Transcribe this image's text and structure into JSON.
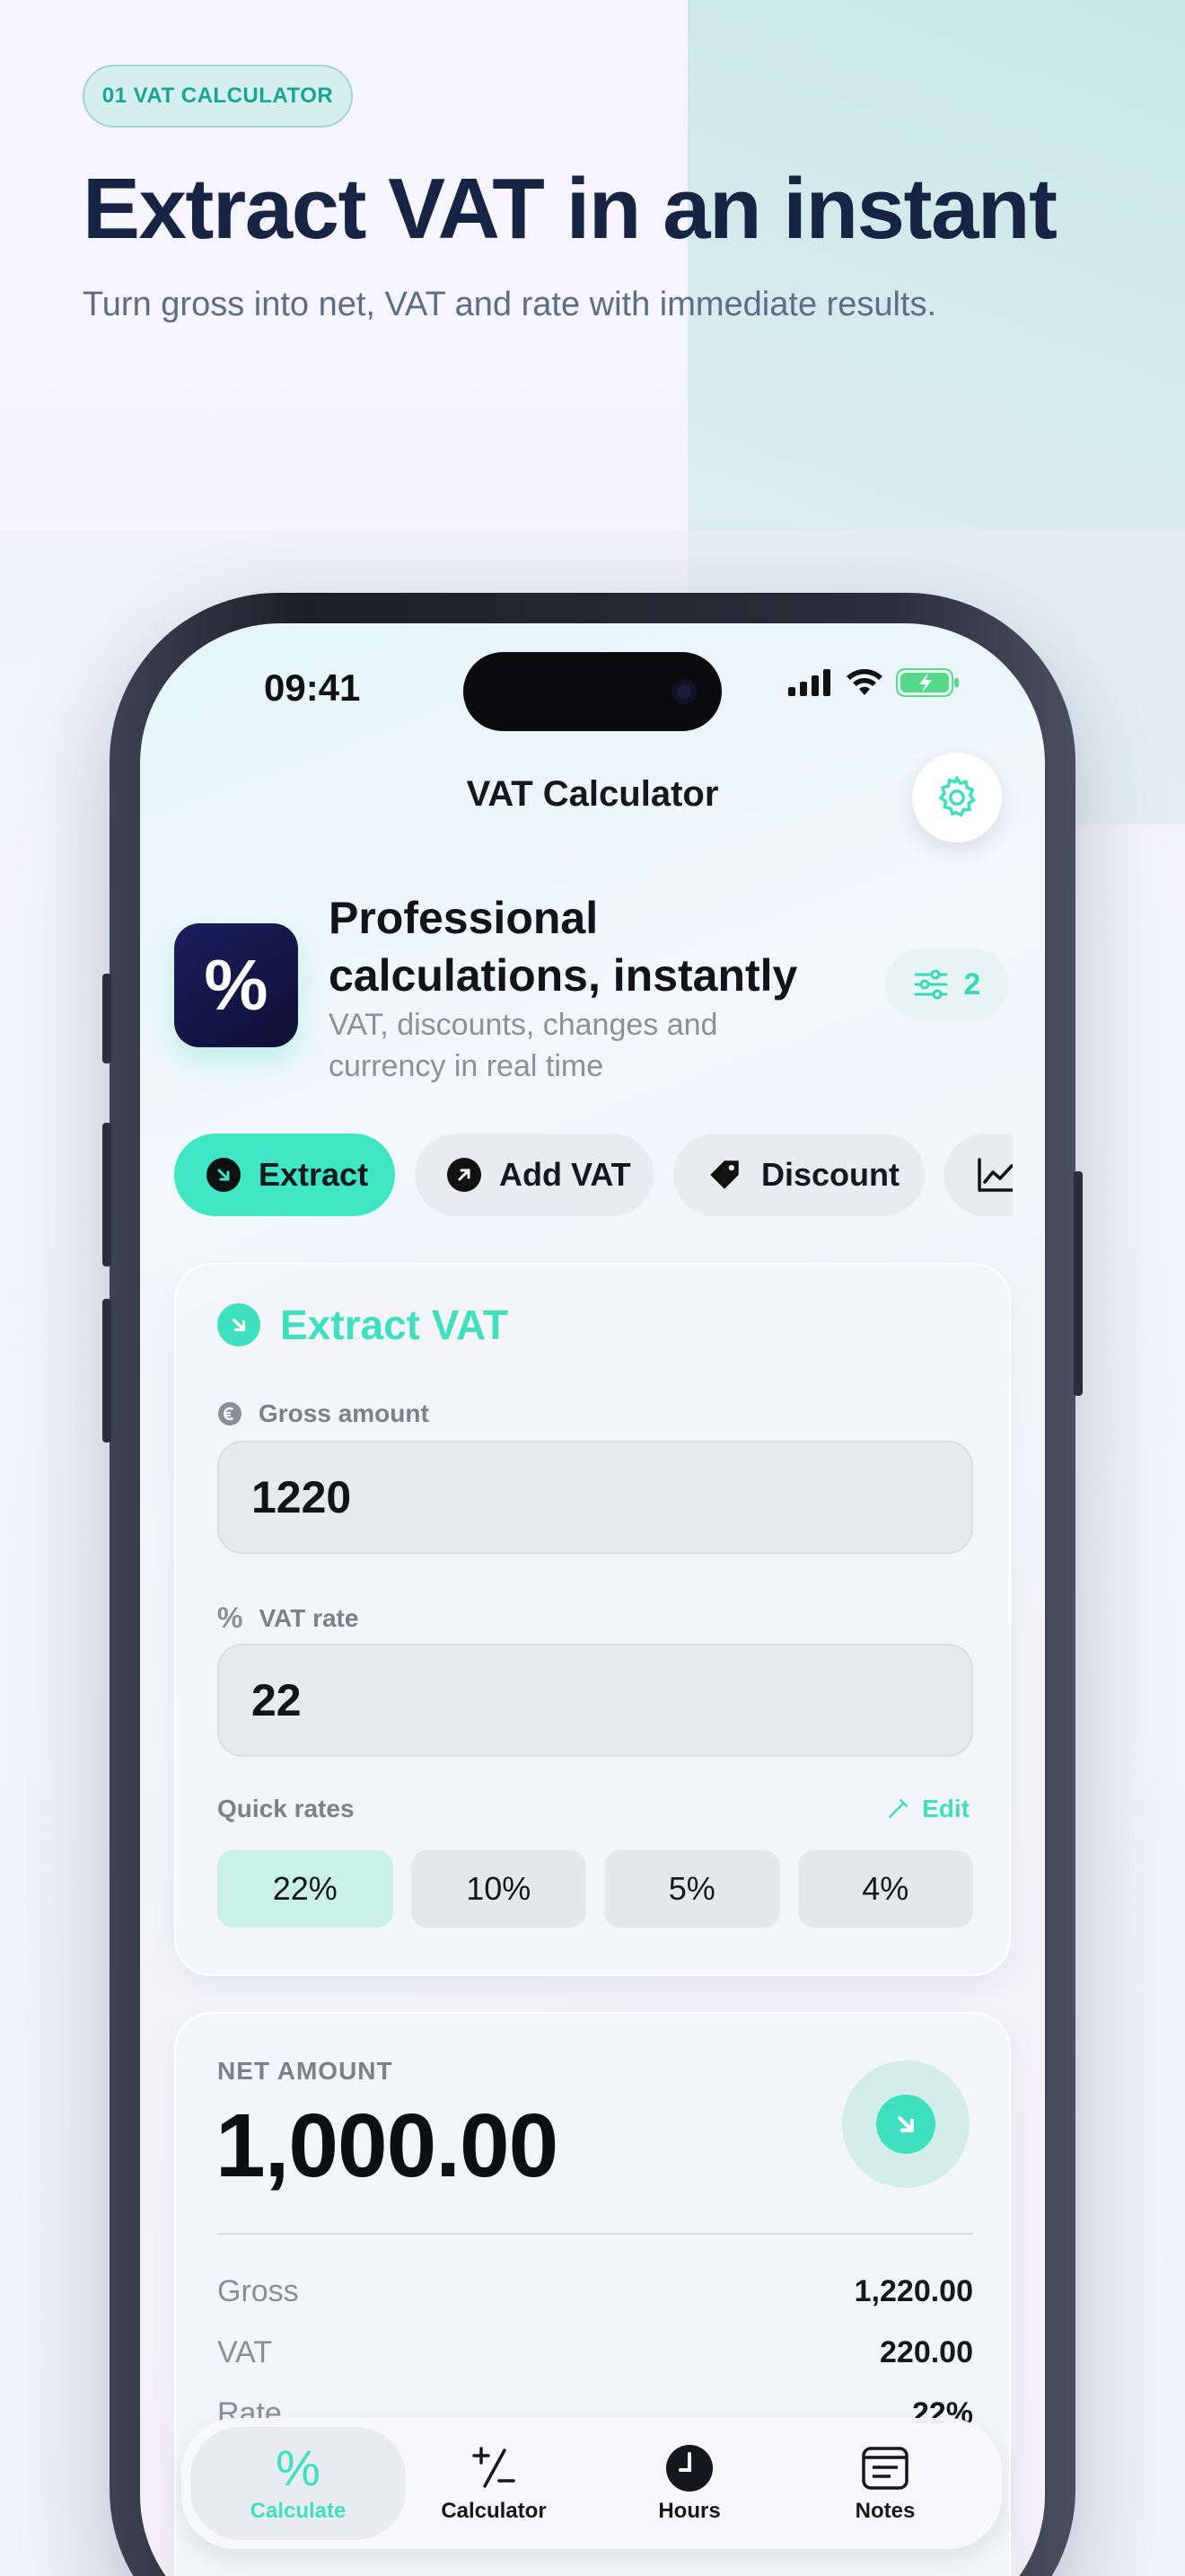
{
  "page": {
    "badge": "01 VAT CALCULATOR",
    "headline": "Extract VAT in an instant",
    "subline": "Turn gross into net, VAT and rate with immediate results."
  },
  "status_bar": {
    "time": "09:41"
  },
  "nav": {
    "title": "VAT Calculator"
  },
  "hero": {
    "title": "Professional calculations, instantly",
    "subtitle": "VAT, discounts, changes and currency in real time",
    "filter_count": "2"
  },
  "tabs": [
    {
      "label": "Extract",
      "icon": "arrow-down-right-icon",
      "active": true
    },
    {
      "label": "Add VAT",
      "icon": "arrow-up-right-icon",
      "active": false
    },
    {
      "label": "Discount",
      "icon": "tag-icon",
      "active": false
    },
    {
      "label": "",
      "icon": "chart-icon",
      "active": false
    }
  ],
  "extract_card": {
    "title": "Extract VAT",
    "gross_label": "Gross amount",
    "gross_value": "1220",
    "rate_label": "VAT rate",
    "rate_value": "22",
    "quick_rates_label": "Quick rates",
    "edit_label": "Edit",
    "quick_rates": [
      "22%",
      "10%",
      "5%",
      "4%"
    ],
    "selected_rate": "22%"
  },
  "result_card": {
    "net_label": "NET AMOUNT",
    "net_value": "1,000.00",
    "rows": [
      {
        "label": "Gross",
        "value": "1,220.00"
      },
      {
        "label": "VAT",
        "value": "220.00"
      },
      {
        "label": "Rate",
        "value": "22%"
      }
    ]
  },
  "tabbar": {
    "items": [
      {
        "label": "Calculate",
        "icon": "percent-icon",
        "active": true
      },
      {
        "label": "Calculator",
        "icon": "plus-minus-icon",
        "active": false
      },
      {
        "label": "Hours",
        "icon": "clock-icon",
        "active": false
      },
      {
        "label": "Notes",
        "icon": "notes-icon",
        "active": false
      }
    ]
  },
  "colors": {
    "accent": "#3fe0bf",
    "headline": "#172443",
    "app_icon": "#15184a"
  }
}
